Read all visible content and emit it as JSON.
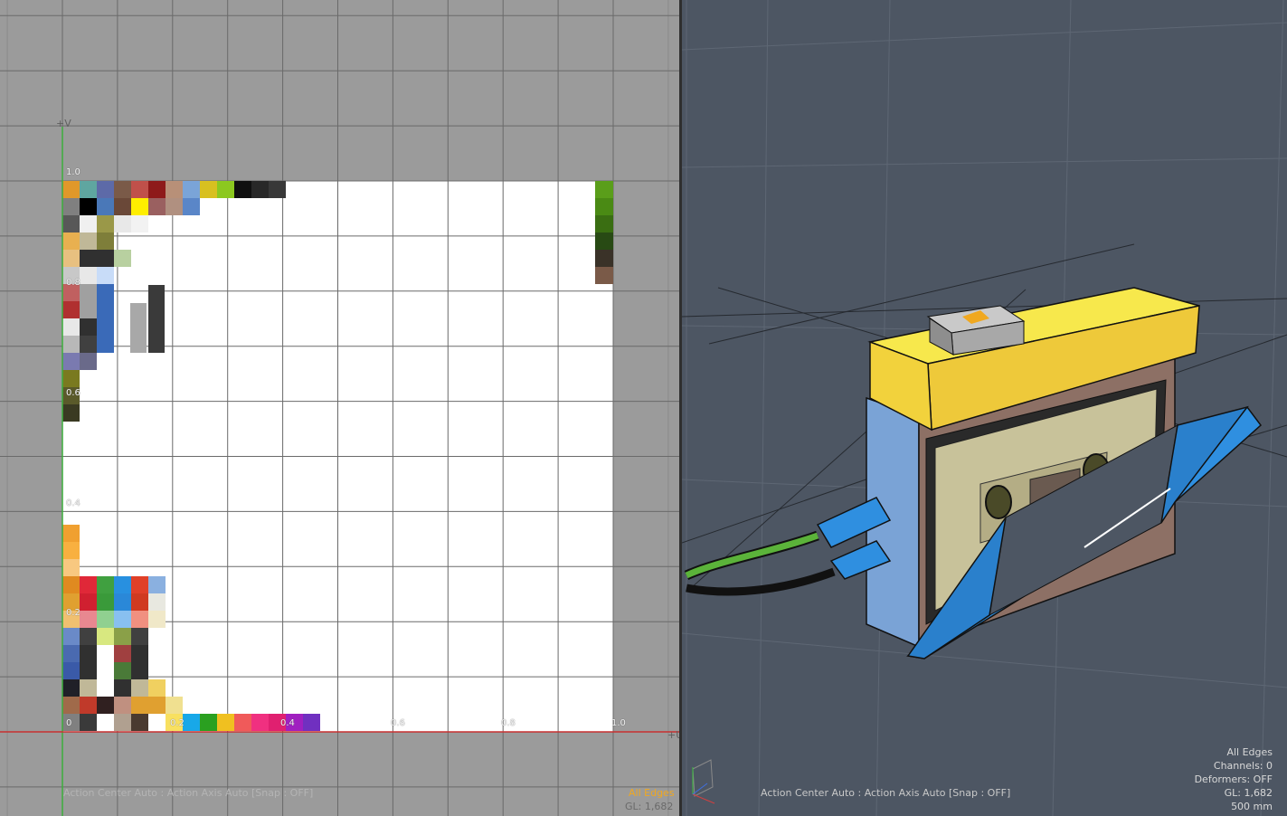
{
  "uv_view": {
    "axis_v_label": "+V",
    "axis_u_label": "+U",
    "ticks": {
      "v_1_0": "1.0",
      "v_0_8": "0.8",
      "v_0_6": "0.6",
      "v_0_4": "0.4",
      "v_0_2": "0.2",
      "origin": "0",
      "u_0_2": "0.2",
      "u_0_4": "0.4",
      "u_0_6": "0.6",
      "u_0_8": "0.8",
      "u_1_0": "1.0"
    },
    "status": "Action Center Auto : Action Axis Auto  [Snap : OFF]",
    "selection_mode": "All Edges",
    "gl_count": "GL: 1,682"
  },
  "perspective_view": {
    "status": "Action Center Auto : Action Axis Auto  [Snap : OFF]",
    "selection_mode": "All Edges",
    "channels": "Channels: 0",
    "deformers": "Deformers: OFF",
    "gl_count": "GL: 1,682",
    "grid_size": "500 mm"
  },
  "colors": {
    "uv_background": "#9b9b9b",
    "uv_tile": "#ffffff",
    "viewport_background": "#4d5663",
    "accent": "#f0a820",
    "model_yellow": "#f2d23c",
    "model_blue": "#2f8fe0",
    "cassette_beige": "#c8c29a"
  }
}
